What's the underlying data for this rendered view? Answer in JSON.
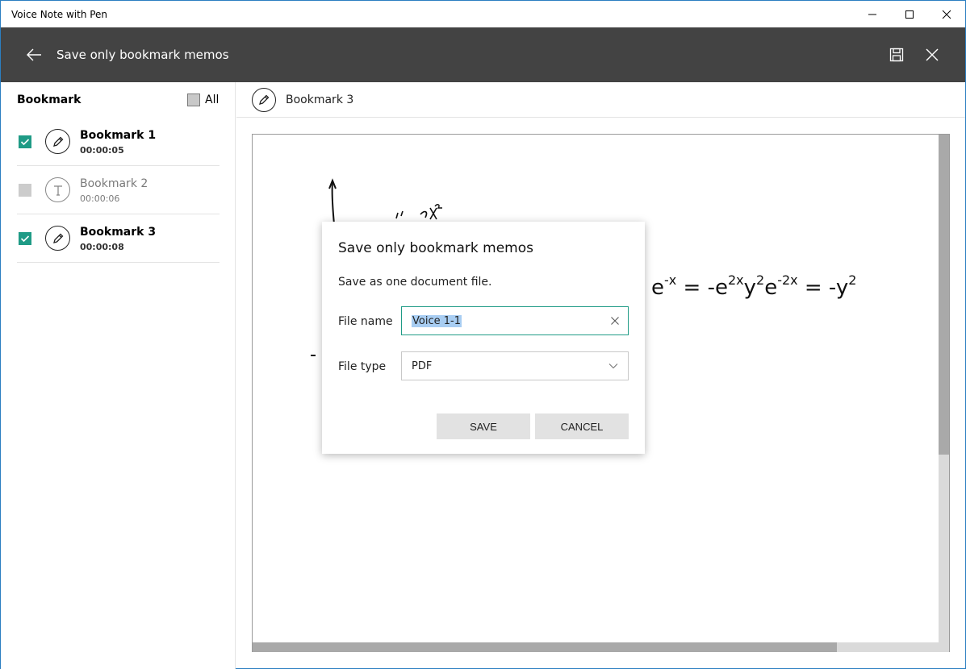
{
  "window": {
    "title": "Voice Note with Pen"
  },
  "header": {
    "title": "Save only bookmark memos"
  },
  "sidebar": {
    "heading": "Bookmark",
    "all_label": "All",
    "items": [
      {
        "name": "Bookmark 1",
        "time": "00:00:05",
        "checked": true,
        "icon": "pen-icon"
      },
      {
        "name": "Bookmark 2",
        "time": "00:00:06",
        "checked": false,
        "icon": "text-icon"
      },
      {
        "name": "Bookmark 3",
        "time": "00:00:08",
        "checked": true,
        "icon": "pen-icon"
      }
    ]
  },
  "main": {
    "title": "Bookmark 3",
    "equation": {
      "p1": "e",
      "s1": "-x",
      "p2": " = -e",
      "s2": "2x",
      "p3": "y",
      "s3": "2",
      "p4": "e",
      "s4": "-2x",
      "p5": " = -y",
      "s5": "2"
    }
  },
  "dialog": {
    "title": "Save only bookmark memos",
    "message": "Save as one document file.",
    "file_name_label": "File name",
    "file_name_value": "Voice 1-1",
    "file_type_label": "File type",
    "file_type_value": "PDF",
    "save_label": "SAVE",
    "cancel_label": "CANCEL"
  },
  "colors": {
    "header_bg": "#434343",
    "accent": "#1f9b86",
    "selection": "#a8cdf2"
  }
}
